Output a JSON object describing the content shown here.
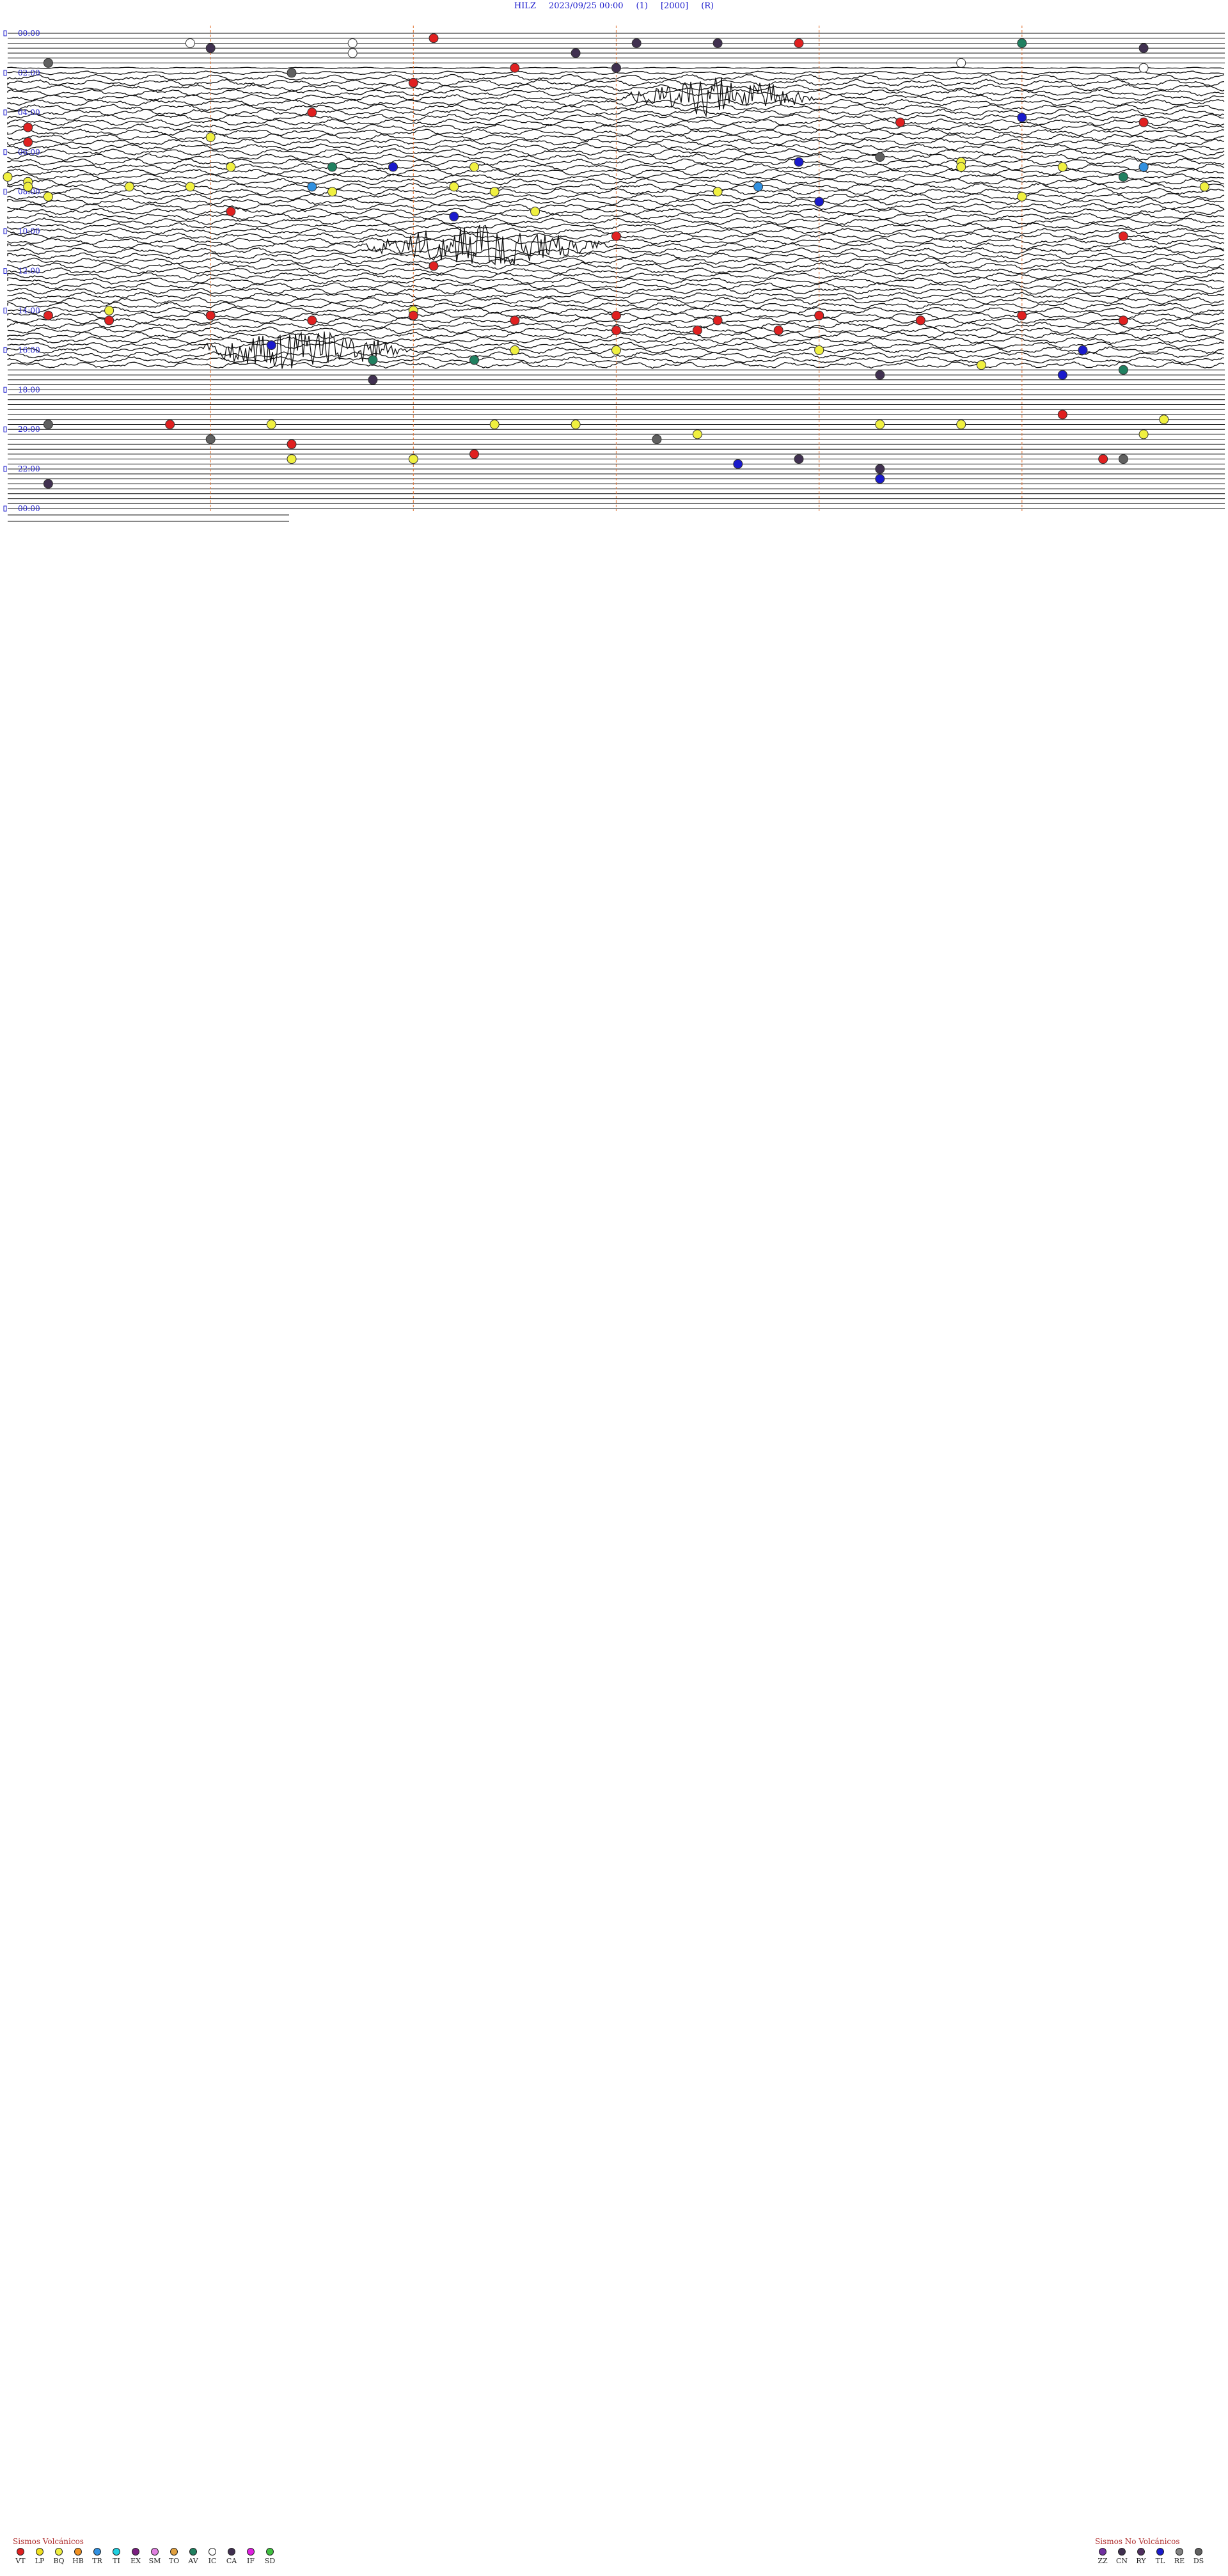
{
  "header": {
    "station": "HILZ",
    "datetime": "2023/09/25 00:00",
    "channel": "(1)",
    "gain": "[2000]",
    "mode": "(R)"
  },
  "chart_data": {
    "type": "seismogram",
    "time_labels": [
      "00:00",
      "02:00",
      "04:00",
      "06:00",
      "08:00",
      "10:00",
      "12:00",
      "14:00",
      "16:00",
      "18:00",
      "20:00",
      "22:00",
      "00:00"
    ],
    "hours": 24,
    "colors": {
      "trace": "#111111",
      "grid_line": "#e07030",
      "label": "#2222cc"
    },
    "events": [
      {
        "hour": 0.2,
        "minute": 21,
        "code": "VT"
      },
      {
        "hour": 0.4,
        "minute": 17,
        "code": "IC"
      },
      {
        "hour": 0.4,
        "minute": 31,
        "code": "CA"
      },
      {
        "hour": 0.4,
        "minute": 39,
        "code": "VT"
      },
      {
        "hour": 0.5,
        "minute": 9,
        "code": "IC"
      },
      {
        "hour": 0.5,
        "minute": 35,
        "code": "CA"
      },
      {
        "hour": 0.6,
        "minute": 50,
        "code": "AV"
      },
      {
        "hour": 0.8,
        "minute": 10,
        "code": "CA"
      },
      {
        "hour": 0.8,
        "minute": 56,
        "code": "CA"
      },
      {
        "hour": 1.1,
        "minute": 17,
        "code": "IC"
      },
      {
        "hour": 1.1,
        "minute": 28,
        "code": "CA"
      },
      {
        "hour": 1.4,
        "minute": 47,
        "code": "IC"
      },
      {
        "hour": 1.5,
        "minute": 2,
        "code": "DS"
      },
      {
        "hour": 1.7,
        "minute": 30,
        "code": "CA"
      },
      {
        "hour": 1.8,
        "minute": 25,
        "code": "VT"
      },
      {
        "hour": 1.8,
        "minute": 56,
        "code": "IC"
      },
      {
        "hour": 2.0,
        "minute": 14,
        "code": "DS"
      },
      {
        "hour": 2.4,
        "minute": 20,
        "code": "VT"
      },
      {
        "hour": 3.9,
        "minute": 15,
        "code": "VT"
      },
      {
        "hour": 4.2,
        "minute": 50,
        "code": "TL"
      },
      {
        "hour": 4.4,
        "minute": 44,
        "code": "VT"
      },
      {
        "hour": 4.4,
        "minute": 56,
        "code": "VT"
      },
      {
        "hour": 4.8,
        "minute": 1,
        "code": "VT"
      },
      {
        "hour": 5.2,
        "minute": 10,
        "code": "BQ"
      },
      {
        "hour": 5.4,
        "minute": 1,
        "code": "VT"
      },
      {
        "hour": 6.2,
        "minute": 43,
        "code": "DS"
      },
      {
        "hour": 6.6,
        "minute": 39,
        "code": "TL"
      },
      {
        "hour": 6.6,
        "minute": 47,
        "code": "BQ"
      },
      {
        "hour": 6.8,
        "minute": 11,
        "code": "BQ"
      },
      {
        "hour": 6.8,
        "minute": 16,
        "code": "AV"
      },
      {
        "hour": 6.8,
        "minute": 19,
        "code": "TL"
      },
      {
        "hour": 6.8,
        "minute": 23,
        "code": "BQ"
      },
      {
        "hour": 6.8,
        "minute": 47,
        "code": "BQ"
      },
      {
        "hour": 6.8,
        "minute": 52,
        "code": "BQ"
      },
      {
        "hour": 6.8,
        "minute": 56,
        "code": "TR"
      },
      {
        "hour": 7.3,
        "minute": 0,
        "code": "BQ"
      },
      {
        "hour": 7.3,
        "minute": 55,
        "code": "AV"
      },
      {
        "hour": 7.6,
        "minute": 1,
        "code": "BQ"
      },
      {
        "hour": 7.8,
        "minute": 1,
        "code": "BQ"
      },
      {
        "hour": 7.8,
        "minute": 6,
        "code": "BQ"
      },
      {
        "hour": 7.8,
        "minute": 9,
        "code": "BQ"
      },
      {
        "hour": 7.8,
        "minute": 15,
        "code": "TR"
      },
      {
        "hour": 7.8,
        "minute": 22,
        "code": "BQ"
      },
      {
        "hour": 7.8,
        "minute": 37,
        "code": "TR"
      },
      {
        "hour": 7.8,
        "minute": 59,
        "code": "BQ"
      },
      {
        "hour": 8.0,
        "minute": 16,
        "code": "BQ"
      },
      {
        "hour": 8.0,
        "minute": 24,
        "code": "BQ"
      },
      {
        "hour": 8.0,
        "minute": 35,
        "code": "BQ"
      },
      {
        "hour": 8.2,
        "minute": 2,
        "code": "BQ"
      },
      {
        "hour": 8.3,
        "minute": 50,
        "code": "BQ"
      },
      {
        "hour": 8.5,
        "minute": 40,
        "code": "TL"
      },
      {
        "hour": 9.0,
        "minute": 11,
        "code": "VT"
      },
      {
        "hour": 9.0,
        "minute": 26,
        "code": "BQ"
      },
      {
        "hour": 9.2,
        "minute": 22,
        "code": "TL"
      },
      {
        "hour": 10.2,
        "minute": 30,
        "code": "VT"
      },
      {
        "hour": 10.2,
        "minute": 55,
        "code": "VT"
      },
      {
        "hour": 11.8,
        "minute": 21,
        "code": "VT"
      },
      {
        "hour": 14.0,
        "minute": 5,
        "code": "BQ"
      },
      {
        "hour": 14.0,
        "minute": 20,
        "code": "BQ"
      },
      {
        "hour": 14.2,
        "minute": 2,
        "code": "VT"
      },
      {
        "hour": 14.2,
        "minute": 10,
        "code": "VT"
      },
      {
        "hour": 14.2,
        "minute": 20,
        "code": "VT"
      },
      {
        "hour": 14.2,
        "minute": 30,
        "code": "VT"
      },
      {
        "hour": 14.2,
        "minute": 40,
        "code": "VT"
      },
      {
        "hour": 14.2,
        "minute": 50,
        "code": "VT"
      },
      {
        "hour": 14.4,
        "minute": 5,
        "code": "VT"
      },
      {
        "hour": 14.4,
        "minute": 15,
        "code": "VT"
      },
      {
        "hour": 14.4,
        "minute": 25,
        "code": "VT"
      },
      {
        "hour": 14.4,
        "minute": 35,
        "code": "VT"
      },
      {
        "hour": 14.4,
        "minute": 45,
        "code": "VT"
      },
      {
        "hour": 14.4,
        "minute": 55,
        "code": "VT"
      },
      {
        "hour": 14.9,
        "minute": 30,
        "code": "VT"
      },
      {
        "hour": 14.9,
        "minute": 34,
        "code": "VT"
      },
      {
        "hour": 14.9,
        "minute": 38,
        "code": "VT"
      },
      {
        "hour": 15.7,
        "minute": 13,
        "code": "TL"
      },
      {
        "hour": 16.0,
        "minute": 25,
        "code": "BQ"
      },
      {
        "hour": 16.0,
        "minute": 30,
        "code": "BQ"
      },
      {
        "hour": 16.0,
        "minute": 40,
        "code": "BQ"
      },
      {
        "hour": 16.0,
        "minute": 53,
        "code": "TL"
      },
      {
        "hour": 16.4,
        "minute": 18,
        "code": "AV"
      },
      {
        "hour": 16.6,
        "minute": 23,
        "code": "AV"
      },
      {
        "hour": 16.8,
        "minute": 48,
        "code": "BQ"
      },
      {
        "hour": 17.0,
        "minute": 55,
        "code": "AV"
      },
      {
        "hour": 17.2,
        "minute": 43,
        "code": "CA"
      },
      {
        "hour": 17.2,
        "minute": 52,
        "code": "TL"
      },
      {
        "hour": 17.6,
        "minute": 18,
        "code": "CA"
      },
      {
        "hour": 19.2,
        "minute": 52,
        "code": "VT"
      },
      {
        "hour": 19.5,
        "minute": 57,
        "code": "BQ"
      },
      {
        "hour": 19.8,
        "minute": 2,
        "code": "DS"
      },
      {
        "hour": 19.8,
        "minute": 8,
        "code": "VT"
      },
      {
        "hour": 19.8,
        "minute": 13,
        "code": "BQ"
      },
      {
        "hour": 19.8,
        "minute": 24,
        "code": "BQ"
      },
      {
        "hour": 19.8,
        "minute": 28,
        "code": "BQ"
      },
      {
        "hour": 19.8,
        "minute": 43,
        "code": "BQ"
      },
      {
        "hour": 19.8,
        "minute": 47,
        "code": "BQ"
      },
      {
        "hour": 20.2,
        "minute": 34,
        "code": "BQ"
      },
      {
        "hour": 20.2,
        "minute": 56,
        "code": "BQ"
      },
      {
        "hour": 20.4,
        "minute": 10,
        "code": "DS"
      },
      {
        "hour": 20.6,
        "minute": 32,
        "code": "DS"
      },
      {
        "hour": 20.8,
        "minute": 14,
        "code": "VT"
      },
      {
        "hour": 21.2,
        "minute": 23,
        "code": "VT"
      },
      {
        "hour": 21.4,
        "minute": 39,
        "code": "CA"
      },
      {
        "hour": 21.4,
        "minute": 54,
        "code": "VT"
      },
      {
        "hour": 21.4,
        "minute": 55,
        "code": "DS"
      },
      {
        "hour": 21.6,
        "minute": 14,
        "code": "BQ"
      },
      {
        "hour": 21.6,
        "minute": 20,
        "code": "BQ"
      },
      {
        "hour": 21.8,
        "minute": 36,
        "code": "TL"
      },
      {
        "hour": 22.0,
        "minute": 43,
        "code": "CA"
      },
      {
        "hour": 22.4,
        "minute": 43,
        "code": "TL"
      },
      {
        "hour": 22.8,
        "minute": 2,
        "code": "CA"
      }
    ],
    "bursts": [
      {
        "hour": 3.2,
        "start_minute": 30,
        "end_minute": 40
      },
      {
        "hour": 10.8,
        "start_minute": 17,
        "end_minute": 30
      },
      {
        "hour": 15.9,
        "start_minute": 9,
        "end_minute": 20
      }
    ]
  },
  "legend_volcanic": {
    "title": "Sismos Volcánicos",
    "items": [
      {
        "code": "VT",
        "color": "#e02020"
      },
      {
        "code": "LP",
        "color": "#f0e020"
      },
      {
        "code": "BQ",
        "color": "#f0f040"
      },
      {
        "code": "HB",
        "color": "#f09020"
      },
      {
        "code": "TR",
        "color": "#3090e0"
      },
      {
        "code": "TI",
        "color": "#20d0e0"
      },
      {
        "code": "EX",
        "color": "#7a2080"
      },
      {
        "code": "SM",
        "color": "#e080e0"
      },
      {
        "code": "TO",
        "color": "#e0a040"
      },
      {
        "code": "AV",
        "color": "#208060"
      },
      {
        "code": "IC",
        "color": "#ffffff"
      },
      {
        "code": "CA",
        "color": "#403050"
      },
      {
        "code": "IF",
        "color": "#e020e0"
      },
      {
        "code": "SD",
        "color": "#40c040"
      }
    ]
  },
  "legend_nonvolcanic": {
    "title": "Sismos No Volcánicos",
    "items": [
      {
        "code": "ZZ",
        "color": "#7030a0"
      },
      {
        "code": "CN",
        "color": "#403050"
      },
      {
        "code": "RY",
        "color": "#503060"
      },
      {
        "code": "TL",
        "color": "#1a1acc"
      },
      {
        "code": "RE",
        "color": "#808080"
      },
      {
        "code": "DS",
        "color": "#606060"
      }
    ]
  }
}
